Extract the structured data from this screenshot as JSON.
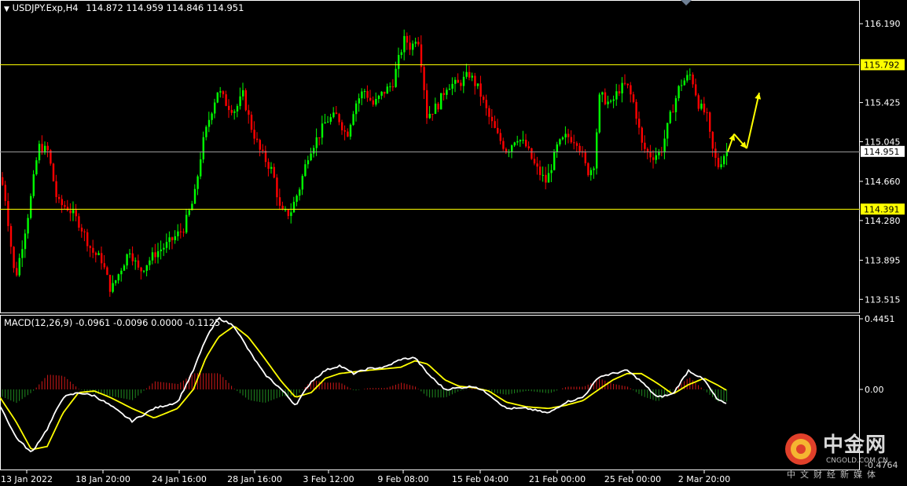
{
  "header": {
    "symbol": "USDJPY.Exp,H4",
    "ohlc": "114.872 114.959 114.846 114.951"
  },
  "macd_header": "MACD(12,26,9) -0.0961 -0.0096 0.0000 -0.1125",
  "colors": {
    "background": "#000000",
    "bull": "#00ff00",
    "bear": "#ff0000",
    "level_line": "#ffff00",
    "signal_line": "#ffff00",
    "macd_line": "#ffffff",
    "hist_up": "#d01818",
    "hist_down": "#1f8a1f",
    "axis_text": "#ffffff",
    "arrow": "#ffff00"
  },
  "chart_data": [
    {
      "type": "candlestick",
      "title": "USDJPY.Exp,H4",
      "ylim": [
        113.38,
        116.42
      ],
      "y_ticks": [
        "116.190",
        "115.425",
        "115.045",
        "114.660",
        "114.280",
        "113.895",
        "113.515"
      ],
      "y_tick_values": [
        116.19,
        115.425,
        115.045,
        114.66,
        114.28,
        113.895,
        113.515
      ],
      "levels": [
        {
          "value": 115.792,
          "label": "115.792"
        },
        {
          "value": 114.391,
          "label": "114.391"
        }
      ],
      "current_price": {
        "value": 114.951,
        "label": "114.951"
      },
      "path_anchors": [
        [
          0,
          114.7
        ],
        [
          6,
          114.48
        ],
        [
          11,
          114.15
        ],
        [
          18,
          113.7
        ],
        [
          26,
          114.0
        ],
        [
          36,
          114.4
        ],
        [
          48,
          115.0
        ],
        [
          60,
          114.95
        ],
        [
          72,
          114.45
        ],
        [
          86,
          114.4
        ],
        [
          100,
          114.25
        ],
        [
          116,
          113.98
        ],
        [
          128,
          113.9
        ],
        [
          140,
          113.6
        ],
        [
          152,
          113.8
        ],
        [
          164,
          114.0
        ],
        [
          176,
          113.78
        ],
        [
          196,
          113.96
        ],
        [
          212,
          114.05
        ],
        [
          232,
          114.2
        ],
        [
          246,
          114.5
        ],
        [
          256,
          115.0
        ],
        [
          266,
          115.3
        ],
        [
          276,
          115.55
        ],
        [
          288,
          115.4
        ],
        [
          298,
          115.35
        ],
        [
          308,
          115.5
        ],
        [
          318,
          115.2
        ],
        [
          330,
          114.95
        ],
        [
          346,
          114.75
        ],
        [
          356,
          114.35
        ],
        [
          368,
          114.35
        ],
        [
          380,
          114.6
        ],
        [
          392,
          114.95
        ],
        [
          404,
          115.1
        ],
        [
          414,
          115.25
        ],
        [
          428,
          115.3
        ],
        [
          440,
          115.1
        ],
        [
          450,
          115.4
        ],
        [
          462,
          115.55
        ],
        [
          474,
          115.4
        ],
        [
          486,
          115.52
        ],
        [
          498,
          115.6
        ],
        [
          508,
          115.9
        ],
        [
          514,
          116.05
        ],
        [
          522,
          115.95
        ],
        [
          530,
          116.1
        ],
        [
          536,
          115.75
        ],
        [
          542,
          115.3
        ],
        [
          556,
          115.4
        ],
        [
          568,
          115.6
        ],
        [
          582,
          115.6
        ],
        [
          596,
          115.7
        ],
        [
          608,
          115.55
        ],
        [
          620,
          115.3
        ],
        [
          632,
          115.1
        ],
        [
          644,
          114.95
        ],
        [
          656,
          115.1
        ],
        [
          668,
          115.0
        ],
        [
          680,
          114.8
        ],
        [
          694,
          114.65
        ],
        [
          708,
          115.0
        ],
        [
          720,
          115.1
        ],
        [
          734,
          115.05
        ],
        [
          746,
          114.75
        ],
        [
          754,
          114.8
        ],
        [
          762,
          115.5
        ],
        [
          776,
          115.4
        ],
        [
          786,
          115.55
        ],
        [
          796,
          115.6
        ],
        [
          806,
          115.4
        ],
        [
          816,
          115.0
        ],
        [
          828,
          114.9
        ],
        [
          840,
          114.95
        ],
        [
          852,
          115.3
        ],
        [
          864,
          115.6
        ],
        [
          878,
          115.7
        ],
        [
          888,
          115.4
        ],
        [
          898,
          115.3
        ],
        [
          904,
          115.0
        ],
        [
          912,
          114.8
        ],
        [
          922,
          114.95
        ]
      ],
      "forecast_arrows": [
        {
          "from": [
            926,
            114.95
          ],
          "to": [
            934,
            115.12
          ]
        },
        {
          "from": [
            934,
            115.12
          ],
          "to": [
            950,
            114.98
          ]
        },
        {
          "from": [
            950,
            114.98
          ],
          "to": [
            966,
            115.52
          ]
        }
      ],
      "x_tick_labels": [
        "13 Jan 2022",
        "18 Jan 20:00",
        "24 Jan 16:00",
        "28 Jan 16:00",
        "3 Feb 12:00",
        "9 Feb 08:00",
        "15 Feb 04:00",
        "21 Feb 00:00",
        "25 Feb 00:00",
        "2 Mar 20:00"
      ],
      "x_tick_positions": [
        34,
        131,
        228,
        324,
        418,
        513,
        611,
        709,
        805,
        896
      ]
    },
    {
      "type": "line",
      "title": "MACD(12,26,9)",
      "ylim": [
        -0.51,
        0.47
      ],
      "y_ticks": [
        "0.4451",
        "0.00"
      ],
      "y_tick_values": [
        0.4451,
        0.0
      ],
      "bottom_label": "-0.4764",
      "series": [
        {
          "name": "MACD",
          "anchors": [
            [
              0,
              -0.1
            ],
            [
              20,
              -0.3
            ],
            [
              40,
              -0.4
            ],
            [
              60,
              -0.25
            ],
            [
              80,
              -0.05
            ],
            [
              100,
              -0.02
            ],
            [
              120,
              -0.04
            ],
            [
              140,
              -0.1
            ],
            [
              168,
              -0.2
            ],
            [
              196,
              -0.12
            ],
            [
              226,
              -0.08
            ],
            [
              246,
              0.12
            ],
            [
              262,
              0.32
            ],
            [
              278,
              0.45
            ],
            [
              298,
              0.4
            ],
            [
              316,
              0.25
            ],
            [
              336,
              0.1
            ],
            [
              358,
              0.0
            ],
            [
              376,
              -0.1
            ],
            [
              396,
              0.05
            ],
            [
              414,
              0.12
            ],
            [
              432,
              0.15
            ],
            [
              450,
              0.1
            ],
            [
              468,
              0.13
            ],
            [
              490,
              0.14
            ],
            [
              510,
              0.19
            ],
            [
              528,
              0.2
            ],
            [
              544,
              0.1
            ],
            [
              566,
              0.0
            ],
            [
              584,
              0.01
            ],
            [
              604,
              0.02
            ],
            [
              622,
              -0.03
            ],
            [
              644,
              -0.12
            ],
            [
              670,
              -0.12
            ],
            [
              698,
              -0.15
            ],
            [
              720,
              -0.08
            ],
            [
              742,
              -0.05
            ],
            [
              762,
              0.08
            ],
            [
              780,
              0.1
            ],
            [
              798,
              0.12
            ],
            [
              816,
              0.05
            ],
            [
              836,
              -0.05
            ],
            [
              856,
              -0.03
            ],
            [
              876,
              0.12
            ],
            [
              896,
              0.06
            ],
            [
              912,
              -0.06
            ],
            [
              926,
              -0.1
            ]
          ]
        },
        {
          "name": "Signal",
          "anchors": [
            [
              0,
              -0.05
            ],
            [
              20,
              -0.2
            ],
            [
              40,
              -0.38
            ],
            [
              60,
              -0.36
            ],
            [
              80,
              -0.15
            ],
            [
              100,
              -0.02
            ],
            [
              120,
              -0.01
            ],
            [
              140,
              -0.05
            ],
            [
              168,
              -0.12
            ],
            [
              196,
              -0.18
            ],
            [
              226,
              -0.12
            ],
            [
              246,
              0.0
            ],
            [
              262,
              0.2
            ],
            [
              278,
              0.33
            ],
            [
              298,
              0.4
            ],
            [
              316,
              0.33
            ],
            [
              336,
              0.2
            ],
            [
              358,
              0.05
            ],
            [
              376,
              -0.05
            ],
            [
              396,
              -0.02
            ],
            [
              414,
              0.07
            ],
            [
              432,
              0.1
            ],
            [
              450,
              0.11
            ],
            [
              468,
              0.12
            ],
            [
              490,
              0.13
            ],
            [
              510,
              0.14
            ],
            [
              528,
              0.18
            ],
            [
              544,
              0.16
            ],
            [
              566,
              0.06
            ],
            [
              584,
              0.02
            ],
            [
              604,
              0.01
            ],
            [
              622,
              -0.01
            ],
            [
              644,
              -0.08
            ],
            [
              670,
              -0.11
            ],
            [
              698,
              -0.12
            ],
            [
              720,
              -0.1
            ],
            [
              742,
              -0.07
            ],
            [
              762,
              0.0
            ],
            [
              780,
              0.06
            ],
            [
              798,
              0.1
            ],
            [
              816,
              0.1
            ],
            [
              836,
              0.04
            ],
            [
              856,
              -0.03
            ],
            [
              876,
              0.03
            ],
            [
              896,
              0.07
            ],
            [
              912,
              0.03
            ],
            [
              926,
              -0.01
            ]
          ]
        }
      ]
    }
  ],
  "watermark": {
    "name": "中金网",
    "domain": "CNGOLD.COM.CN",
    "subtitle": "中文财经新媒体"
  }
}
